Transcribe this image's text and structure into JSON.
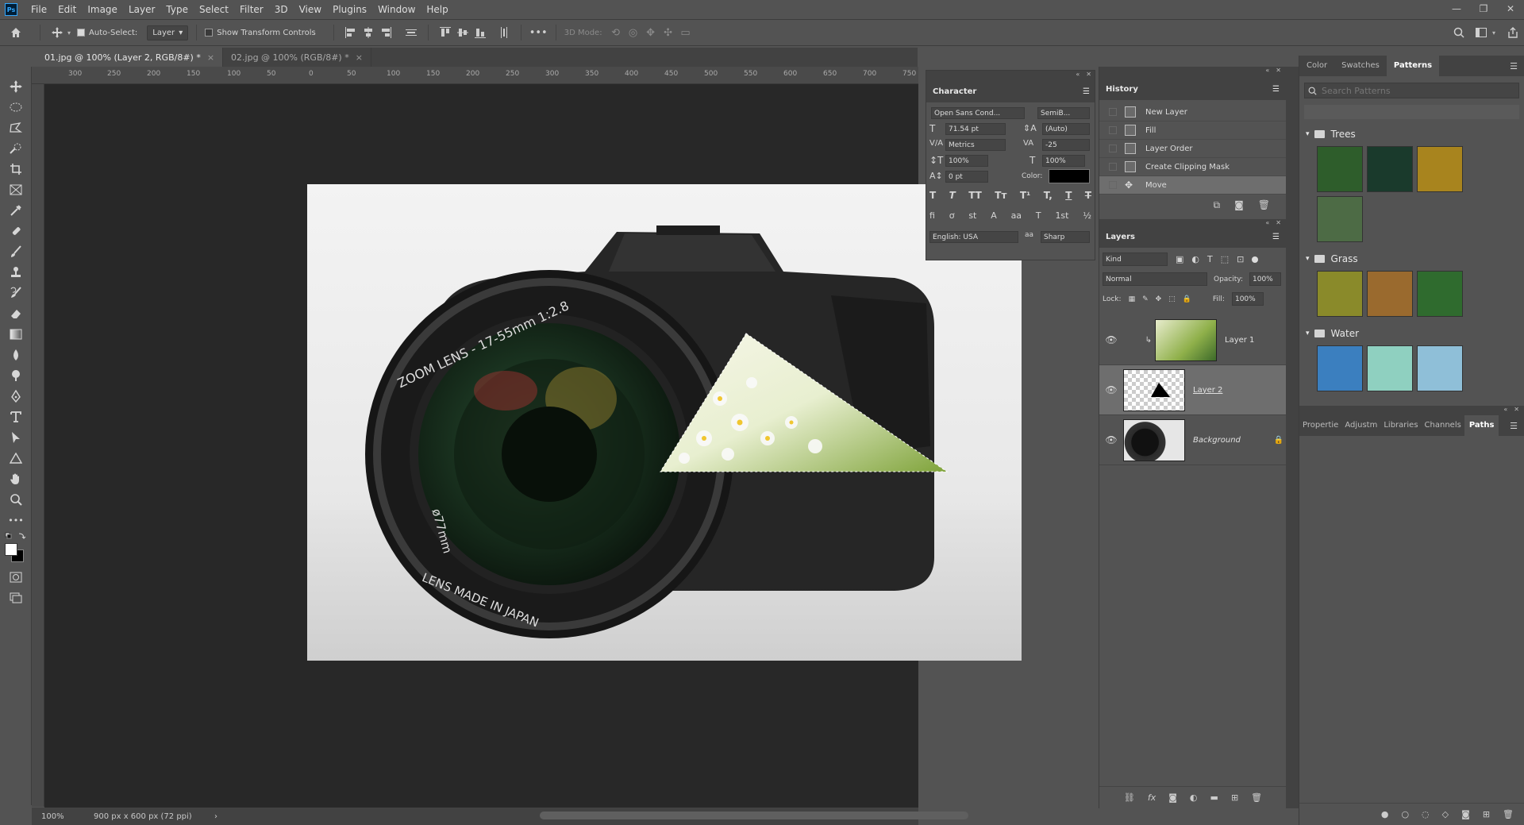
{
  "app": {
    "logo": "Ps"
  },
  "menu": [
    "File",
    "Edit",
    "Image",
    "Layer",
    "Type",
    "Select",
    "Filter",
    "3D",
    "View",
    "Plugins",
    "Window",
    "Help"
  ],
  "window_controls": {
    "minimize": "—",
    "restore": "❐",
    "close": "✕"
  },
  "options": {
    "auto_select_label": "Auto-Select:",
    "auto_select_value": "Layer",
    "show_transform_label": "Show Transform Controls",
    "mode_3d_label": "3D Mode:"
  },
  "tabs": [
    {
      "label": "01.jpg @ 100% (Layer 2, RGB/8#) *",
      "close": "×"
    },
    {
      "label": "02.jpg @ 100% (RGB/8#) *",
      "close": "×"
    }
  ],
  "ruler_ticks": [
    "300",
    "250",
    "200",
    "150",
    "100",
    "50",
    "0",
    "50",
    "100",
    "150",
    "200",
    "250",
    "300",
    "350",
    "400",
    "450",
    "500",
    "550",
    "600",
    "650",
    "700",
    "750"
  ],
  "status": {
    "zoom": "100%",
    "doc_info": "900 px x 600 px (72 ppi)",
    "arrow": "›"
  },
  "character": {
    "title": "Character",
    "font_family": "Open Sans Cond...",
    "font_style": "SemiB...",
    "size": "71.54 pt",
    "leading": "(Auto)",
    "kerning": "Metrics",
    "tracking": "-25",
    "vscale": "100%",
    "hscale": "100%",
    "baseline": "0 pt",
    "color_label": "Color:",
    "color_value": "#000000",
    "language": "English: USA",
    "aa_label": "aa",
    "antialias": "Sharp",
    "style_buttons": [
      "T",
      "T",
      "TT",
      "Tт",
      "T¹",
      "T,",
      "T",
      "T"
    ],
    "ot_buttons": [
      "fi",
      "ơ",
      "st",
      "A",
      "aa",
      "T",
      "1st",
      "½"
    ]
  },
  "history": {
    "title": "History",
    "items": [
      "New Layer",
      "Fill",
      "Layer Order",
      "Create Clipping Mask",
      "Move"
    ]
  },
  "layers": {
    "title": "Layers",
    "kind": "Kind",
    "blend": "Normal",
    "opacity_label": "Opacity:",
    "opacity": "100%",
    "lock_label": "Lock:",
    "fill_label": "Fill:",
    "fill": "100%",
    "items": [
      {
        "name": "Layer 1"
      },
      {
        "name": "Layer 2"
      },
      {
        "name": "Background"
      }
    ]
  },
  "patterns": {
    "tabs": [
      "Color",
      "Swatches",
      "Patterns"
    ],
    "search_placeholder": "Search Patterns",
    "groups": [
      {
        "name": "Trees",
        "colors": [
          "#2e5d2b",
          "#1a3a2c",
          "#a8841e",
          "#4d6b45"
        ]
      },
      {
        "name": "Grass",
        "colors": [
          "#8a8a2a",
          "#9a6a2e",
          "#2f6b2e"
        ]
      },
      {
        "name": "Water",
        "colors": [
          "#3b7fbf",
          "#8fd0c0",
          "#8fbfd8"
        ]
      }
    ]
  },
  "properties_tabs": [
    "Propertie",
    "Adjustm",
    "Libraries",
    "Channels",
    "Paths"
  ],
  "lens_text": {
    "top": "ZOOM LENS  -  17-55mm  1:2.8",
    "bottom": "LENS MADE IN JAPAN",
    "side": "ø77mm"
  }
}
